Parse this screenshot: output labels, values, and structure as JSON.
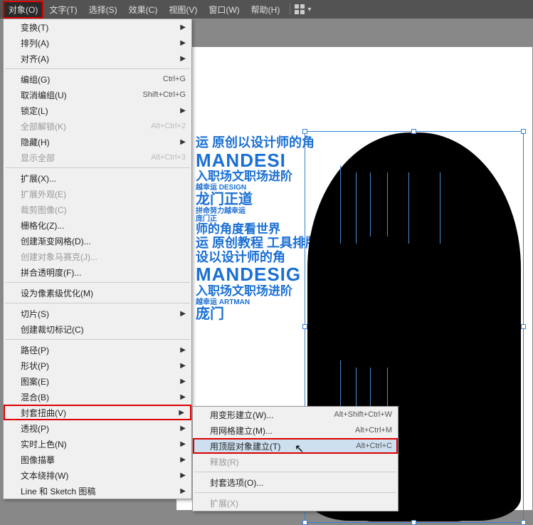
{
  "menubar": {
    "items": [
      "对象(O)",
      "文字(T)",
      "选择(S)",
      "效果(C)",
      "视图(V)",
      "窗口(W)",
      "帮助(H)"
    ]
  },
  "canvas_text": {
    "l1": "运 原创以设计师的角",
    "l2": "MANDESI",
    "l3": "入职场文职场进阶",
    "l4a": "越幸运",
    "l4b": "DESIGN",
    "l5": "龙门正道",
    "l6": "拼命努力越幸运",
    "l7": "庞门正",
    "l8": "师的角度看世界",
    "l9": "运 原创教程 工具排版",
    "l10": "设以设计师的角",
    "l11": "MANDESIG",
    "l12": "入职场文职场进阶",
    "l13a": "越幸运",
    "l13b": "ARTMAN",
    "l14": "庞门"
  },
  "menu": {
    "items": [
      {
        "label": "变换(T)",
        "arrow": true
      },
      {
        "label": "排列(A)",
        "arrow": true
      },
      {
        "label": "对齐(A)",
        "arrow": true
      },
      {
        "sep": true
      },
      {
        "label": "编组(G)",
        "shortcut": "Ctrl+G"
      },
      {
        "label": "取消编组(U)",
        "shortcut": "Shift+Ctrl+G"
      },
      {
        "label": "锁定(L)",
        "arrow": true
      },
      {
        "label": "全部解锁(K)",
        "shortcut": "Alt+Ctrl+2",
        "disabled": true
      },
      {
        "label": "隐藏(H)",
        "arrow": true
      },
      {
        "label": "显示全部",
        "shortcut": "Alt+Ctrl+3",
        "disabled": true
      },
      {
        "sep": true
      },
      {
        "label": "扩展(X)..."
      },
      {
        "label": "扩展外观(E)",
        "disabled": true
      },
      {
        "label": "裁剪图像(C)",
        "disabled": true
      },
      {
        "label": "栅格化(Z)..."
      },
      {
        "label": "创建渐变网格(D)..."
      },
      {
        "label": "创建对象马赛克(J)...",
        "disabled": true
      },
      {
        "label": "拼合透明度(F)..."
      },
      {
        "sep": true
      },
      {
        "label": "设为像素级优化(M)"
      },
      {
        "sep": true
      },
      {
        "label": "切片(S)",
        "arrow": true
      },
      {
        "label": "创建裁切标记(C)"
      },
      {
        "sep": true
      },
      {
        "label": "路径(P)",
        "arrow": true
      },
      {
        "label": "形状(P)",
        "arrow": true
      },
      {
        "label": "图案(E)",
        "arrow": true
      },
      {
        "label": "混合(B)",
        "arrow": true
      },
      {
        "label": "封套扭曲(V)",
        "arrow": true,
        "hl": true
      },
      {
        "label": "透视(P)",
        "arrow": true
      },
      {
        "label": "实时上色(N)",
        "arrow": true
      },
      {
        "label": "图像描摹",
        "arrow": true
      },
      {
        "label": "文本绕排(W)",
        "arrow": true
      },
      {
        "label": "Line 和 Sketch 图稿",
        "arrow": true
      }
    ]
  },
  "submenu": {
    "items": [
      {
        "label": "用变形建立(W)...",
        "shortcut": "Alt+Shift+Ctrl+W"
      },
      {
        "label": "用网格建立(M)...",
        "shortcut": "Alt+Ctrl+M"
      },
      {
        "label": "用顶层对象建立(T)",
        "shortcut": "Alt+Ctrl+C",
        "hl": true,
        "hover": true
      },
      {
        "label": "释放(R)",
        "disabled": true
      },
      {
        "sep": true
      },
      {
        "label": "封套选项(O)..."
      },
      {
        "sep": true
      },
      {
        "label": "扩展(X)",
        "disabled": true
      }
    ]
  }
}
